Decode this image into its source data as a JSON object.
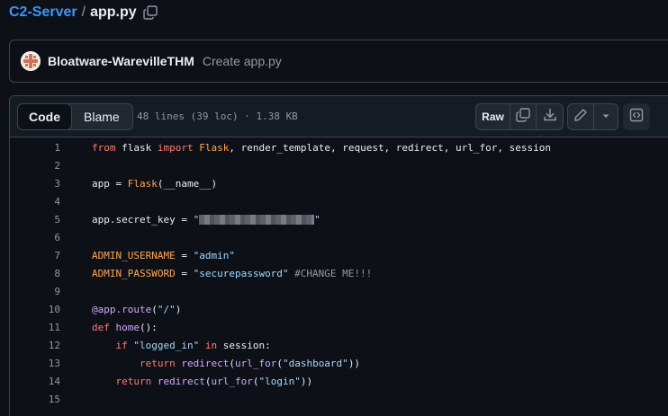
{
  "breadcrumb": {
    "repo": "C2-Server",
    "separator": "/",
    "file": "app.py"
  },
  "commit": {
    "author": "Bloatware-WarevilleTHM",
    "message": "Create app.py"
  },
  "file_header": {
    "tabs": [
      {
        "label": "Code",
        "active": true
      },
      {
        "label": "Blame",
        "active": false
      }
    ],
    "meta": "48 lines (39 loc) · 1.38 KB",
    "raw_label": "Raw",
    "icons": [
      "copy-icon",
      "download-icon",
      "pencil-icon",
      "chevron-down-icon",
      "symbols-icon"
    ]
  },
  "code": {
    "line_numbers": [
      "1",
      "2",
      "3",
      "4",
      "5",
      "6",
      "7",
      "8",
      "9",
      "10",
      "11",
      "12",
      "13",
      "14",
      "15"
    ],
    "tokens": {
      "l1_from": "from",
      "l1_flask": "flask",
      "l1_import": "import",
      "l1_Flask": "Flask",
      "l1_rest": ", render_template, request, redirect, url_for, session",
      "l3_app": "app = ",
      "l3_Flask": "Flask",
      "l3_rest": "(__name__)",
      "l5_app": "app.secret_key = ",
      "l5_q1": "\"",
      "l5_q2": "\"",
      "l7_var": "ADMIN_USERNAME",
      "l7_eq": " = ",
      "l7_str": "\"admin\"",
      "l8_var": "ADMIN_PASSWORD",
      "l8_eq": " = ",
      "l8_str": "\"securepassword\"",
      "l8_cm": " #CHANGE ME!!!",
      "l10_dec": "@app.route",
      "l10_p1": "(",
      "l10_str": "\"/\"",
      "l10_p2": ")",
      "l11_def": "def",
      "l11_fn": " home",
      "l11_rest": "():",
      "l12_ind": "    ",
      "l12_if": "if",
      "l12_str": " \"logged_in\"",
      "l12_in": " in",
      "l12_rest": " session:",
      "l13_ind": "        ",
      "l13_ret": "return",
      "l13_fn": " redirect",
      "l13_p1": "(",
      "l13_fn2": "url_for",
      "l13_p2": "(",
      "l13_str": "\"dashboard\"",
      "l13_p3": "))",
      "l14_ind": "    ",
      "l14_ret": "return",
      "l14_fn": " redirect",
      "l14_p1": "(",
      "l14_fn2": "url_for",
      "l14_p2": "(",
      "l14_str": "\"login\"",
      "l14_p3": "))"
    }
  },
  "colors": {
    "background": "#0d1117",
    "link": "#4493f8",
    "keyword": "#ff7b72",
    "string": "#a5d6ff",
    "function": "#d2a8ff",
    "constant": "#ffa657"
  }
}
